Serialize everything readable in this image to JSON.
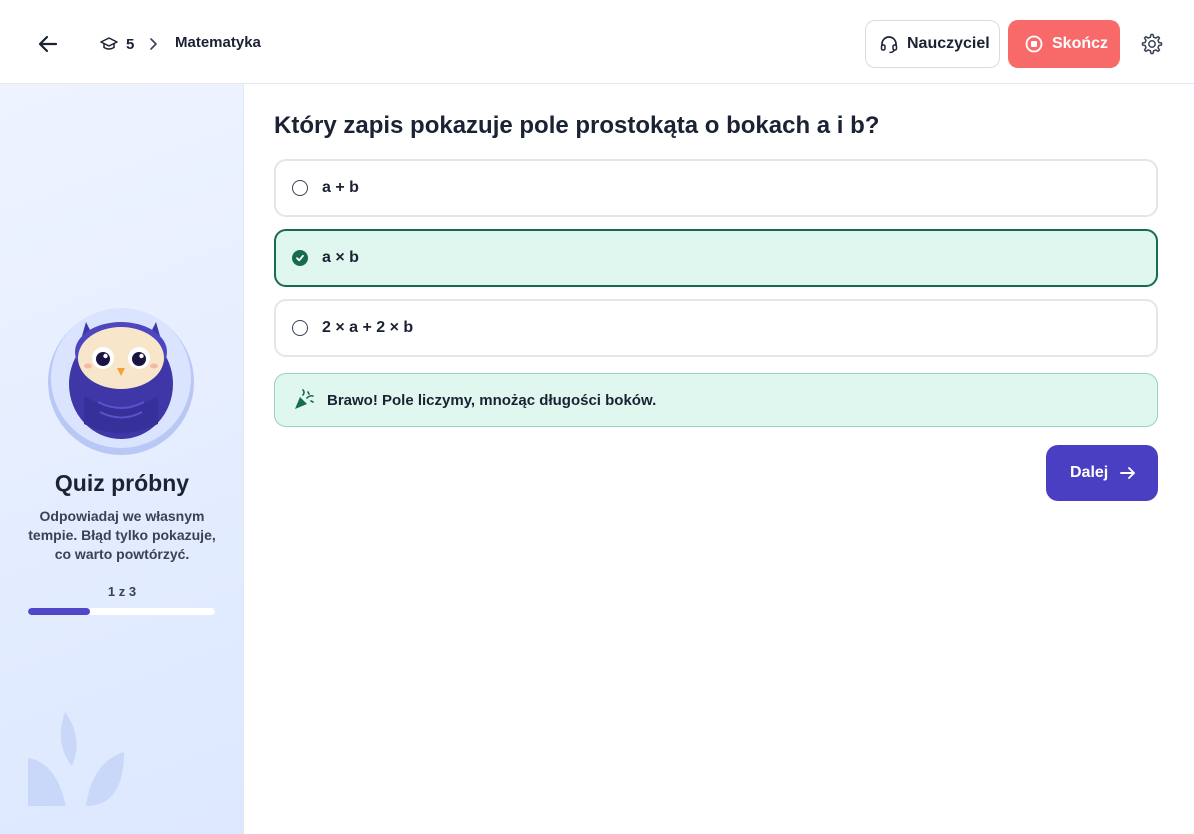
{
  "header": {
    "grade_number": "5",
    "subject": "Matematyka",
    "teacher_label": "Nauczyciel",
    "end_label": "Skończ"
  },
  "sidebar": {
    "title": "Quiz próbny",
    "description": "Odpowiadaj we własnym tempie. Błąd tylko pokazuje, co warto powtórzyć.",
    "progress_label": "1 z 3",
    "progress_fraction": 0.33
  },
  "quiz": {
    "question": "Który zapis pokazuje pole prostokąta o bokach a i b?",
    "options": [
      {
        "label": "a + b",
        "selected": false
      },
      {
        "label": "a × b",
        "selected": true
      },
      {
        "label": "2 × a + 2 × b",
        "selected": false
      }
    ],
    "feedback": "Brawo! Pole liczymy, mnożąc długości boków.",
    "next_label": "Dalej"
  },
  "colors": {
    "accent": "#4a3fc2",
    "end_button": "#f86a6a",
    "correct": "#176b4e",
    "correct_bg": "#dff7ee"
  },
  "icons": {
    "back": "arrow-left-icon",
    "grade": "graduation-cap-icon",
    "breadcrumb": "chevron-right-icon",
    "teacher": "headset-icon",
    "end": "stop-icon",
    "settings": "gear-icon",
    "feedback": "party-popper-icon",
    "next": "arrow-right-icon"
  }
}
